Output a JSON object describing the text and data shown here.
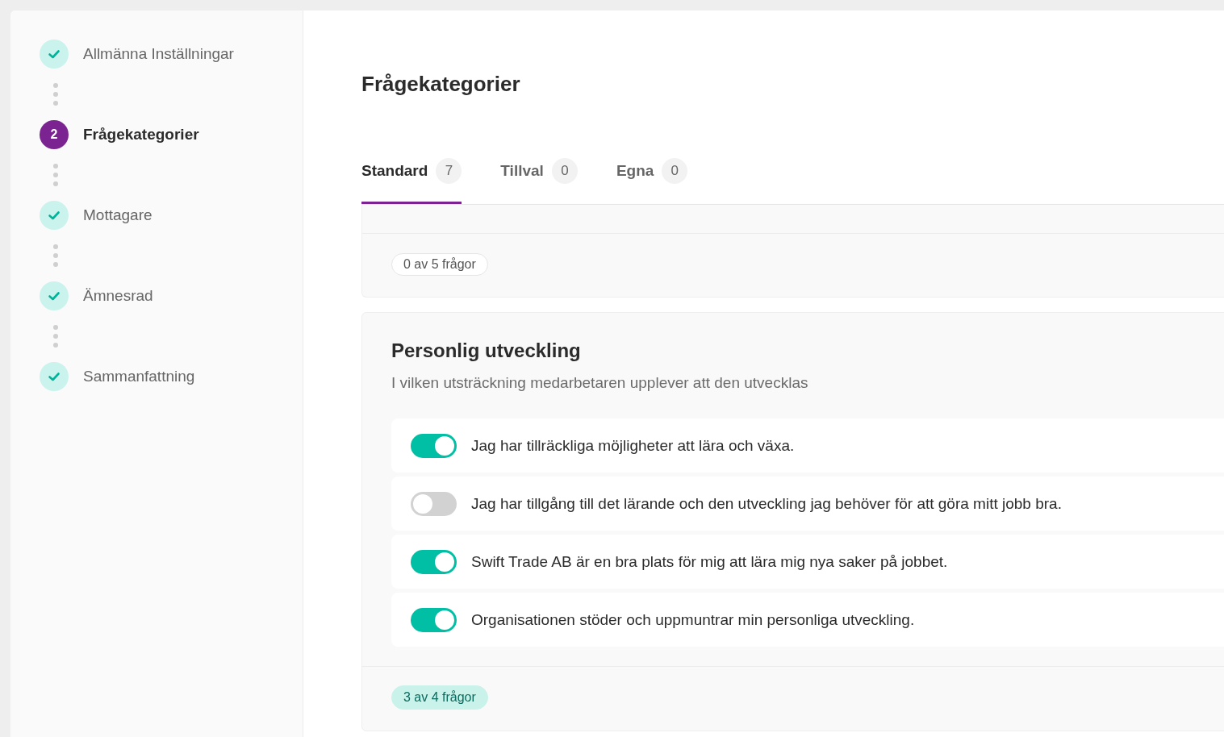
{
  "steps": [
    {
      "label": "Allmänna Inställningar",
      "done": true,
      "selected": false
    },
    {
      "label": "Frågekategorier",
      "number": "2",
      "done": false,
      "selected": true
    },
    {
      "label": "Mottagare",
      "done": true,
      "selected": false
    },
    {
      "label": "Ämnesrad",
      "done": true,
      "selected": false
    },
    {
      "label": "Sammanfattning",
      "done": true,
      "selected": false
    }
  ],
  "title": "Frågekategorier",
  "tabs": [
    {
      "label": "Standard",
      "count": "7",
      "selected": true
    },
    {
      "label": "Tillval",
      "count": "0",
      "selected": false
    },
    {
      "label": "Egna",
      "count": "0",
      "selected": false
    }
  ],
  "summary_panel": {
    "badge": {
      "label": "0 av 5 frågor",
      "highlighted": false
    }
  },
  "categories": [
    {
      "title": "Personlig utveckling",
      "description": "I vilken utsträckning medarbetaren upplever att den utvecklas",
      "questions": [
        {
          "text": "Jag har tillräckliga möjligheter att lära och växa.",
          "on": true
        },
        {
          "text": "Jag har tillgång till det lärande och den utveckling jag behöver för att göra mitt jobb bra.",
          "on": false
        },
        {
          "text": "Swift Trade AB är en bra plats för mig att lära mig nya saker på jobbet.",
          "on": true
        },
        {
          "text": "Organisationen stöder och uppmuntrar min personliga utveckling.",
          "on": true
        }
      ],
      "badge": {
        "label": "3 av 4 frågor",
        "highlighted": true
      }
    }
  ]
}
